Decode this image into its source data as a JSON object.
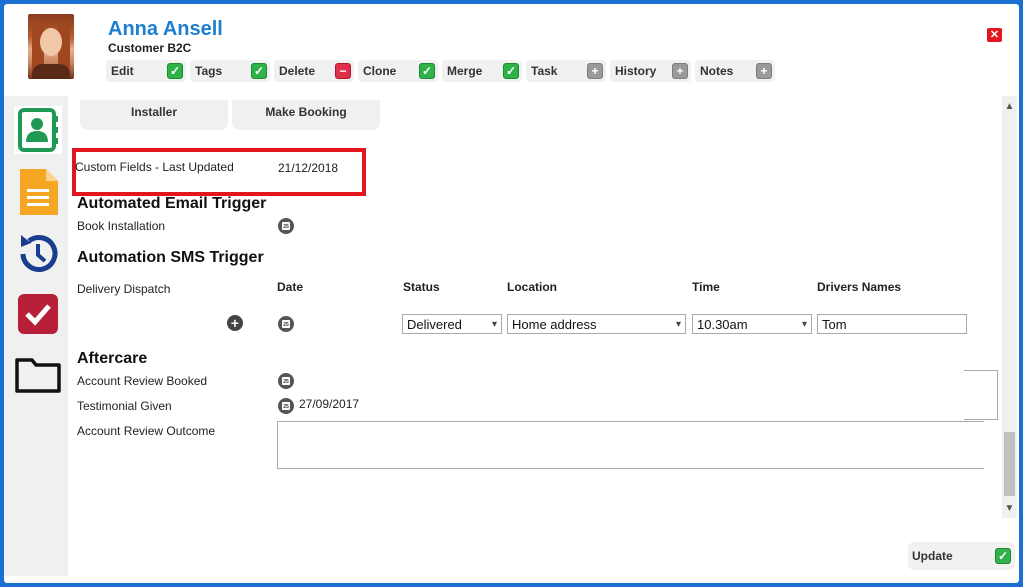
{
  "contact": {
    "name": "Anna Ansell",
    "type": "Customer B2C"
  },
  "toolbar": {
    "items": [
      {
        "label": "Edit",
        "icon": "check-icon"
      },
      {
        "label": "Tags",
        "icon": "check-icon"
      },
      {
        "label": "Delete",
        "icon": "minus-icon"
      },
      {
        "label": "Clone",
        "icon": "check-icon"
      },
      {
        "label": "Merge",
        "icon": "check-icon"
      },
      {
        "label": "Task",
        "icon": "plus-icon"
      },
      {
        "label": "History",
        "icon": "plus-icon"
      },
      {
        "label": "Notes",
        "icon": "plus-icon"
      }
    ]
  },
  "sidenav": {
    "items": [
      "contact-card-icon",
      "document-icon",
      "history-icon",
      "task-check-icon",
      "folder-icon"
    ]
  },
  "tabs": [
    "Installer",
    "Make Booking"
  ],
  "custom_fields": {
    "label": "Custom Fields - Last Updated",
    "date": "21/12/2018"
  },
  "email_trigger": {
    "title": "Automated Email Trigger",
    "book_installation": "Book Installation"
  },
  "sms_trigger": {
    "title": "Automation SMS Trigger",
    "delivery_dispatch": "Delivery Dispatch",
    "columns": {
      "date": "Date",
      "status": "Status",
      "location": "Location",
      "time": "Time",
      "drivers": "Drivers Names"
    },
    "row": {
      "status": "Delivered",
      "location": "Home address",
      "time": "10.30am",
      "driver": "Tom"
    }
  },
  "aftercare": {
    "title": "Aftercare",
    "account_review_booked": "Account Review Booked",
    "testimonial_given": "Testimonial Given",
    "testimonial_date": "27/09/2017",
    "account_review_outcome": "Account Review Outcome"
  },
  "update": {
    "label": "Update"
  },
  "colors": {
    "accent": "#1e7fd0",
    "highlight": "#e3161f",
    "check": "#2fb24a",
    "delete": "#e0314b"
  }
}
